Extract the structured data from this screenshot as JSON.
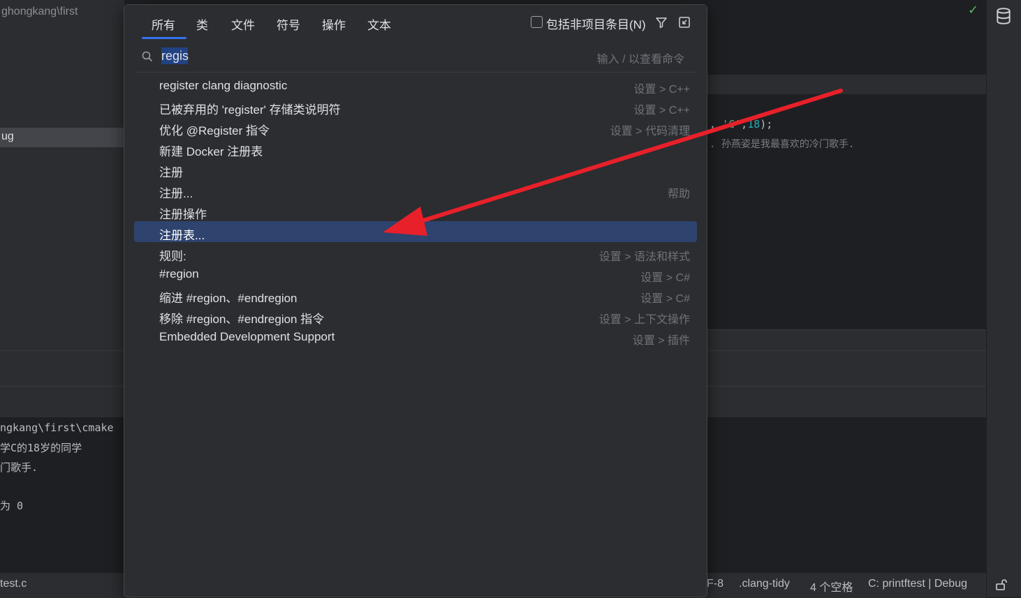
{
  "background": {
    "project_path": "ghongkang\\first",
    "selected_tree_item": "ug",
    "editor_line1": {
      "pre": ", ",
      "str": "'C'",
      "mid": ",",
      "num": "18",
      "post": ");"
    },
    "editor_line2": ". 孙燕姿是我最喜欢的冷门歌手.",
    "terminal_lines": [
      "ngkang\\first\\cmake",
      "学C的18岁的同学",
      "门歌手.",
      "",
      "为 0"
    ]
  },
  "status_bar": {
    "file": "test.c",
    "encoding": "F-8",
    "tidy": ".clang-tidy",
    "indent": "4 个空格",
    "context": "C: printftest | Debug"
  },
  "popup": {
    "tabs": [
      "所有",
      "类",
      "文件",
      "符号",
      "操作",
      "文本"
    ],
    "active_tab": "所有",
    "include_label": "包括非项目条目(N)",
    "search": {
      "value": "regis",
      "hint": "输入 / 以查看命令"
    },
    "results": [
      {
        "label": "register clang diagnostic",
        "location": "设置 > C++"
      },
      {
        "label": "已被弃用的 'register' 存储类说明符",
        "location": "设置 > C++"
      },
      {
        "label": "优化 @Register 指令",
        "location": "设置 > 代码清理"
      },
      {
        "label": "新建 Docker 注册表",
        "location": ""
      },
      {
        "label": "注册",
        "location": ""
      },
      {
        "label": "注册...",
        "location": "帮助"
      },
      {
        "label": "注册操作",
        "location": ""
      },
      {
        "label": "注册表...",
        "location": "",
        "selected": true
      },
      {
        "label": "规则:",
        "location": "设置 > 语法和样式"
      },
      {
        "label": "#region",
        "location": "设置 > C#"
      },
      {
        "label": "缩进 #region、#endregion",
        "location": "设置 > C#"
      },
      {
        "label": "移除 #region、#endregion 指令",
        "location": "设置 > 上下文操作"
      },
      {
        "label": "Embedded Development Support",
        "location": "设置 > 插件"
      }
    ]
  },
  "colors": {
    "accent": "#3574f0",
    "selection": "#2e436e",
    "arrow": "#e8202a"
  },
  "icons": [
    "search-icon",
    "filter-icon",
    "collapse-icon",
    "check-icon",
    "database-icon",
    "lock-icon"
  ]
}
